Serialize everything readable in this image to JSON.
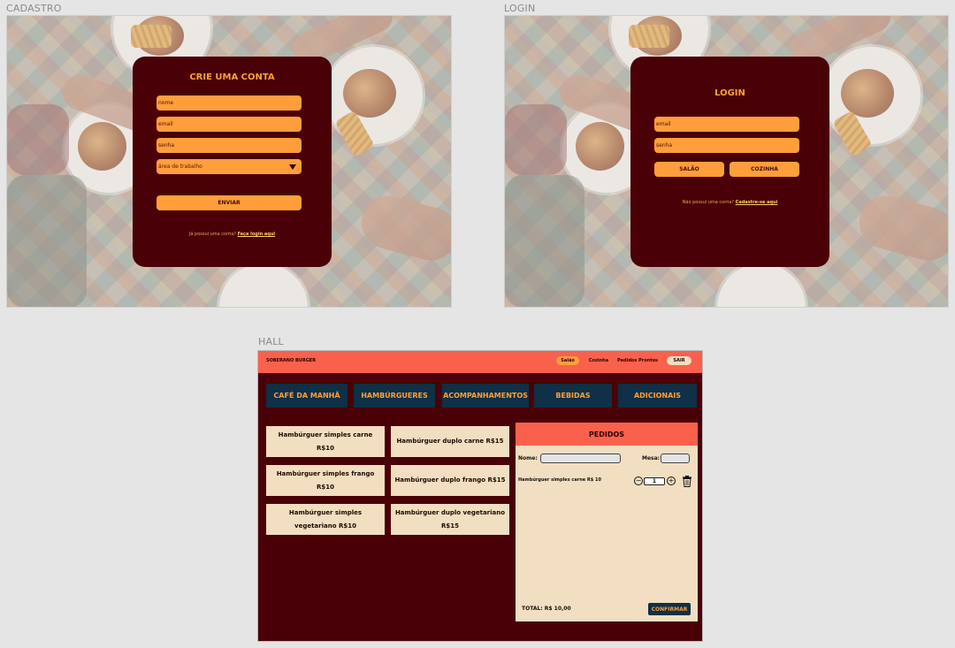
{
  "frames": {
    "cadastro_label": "CADASTRO",
    "login_label": "LOGIN",
    "hall_label": "HALL"
  },
  "cadastro": {
    "title": "CRIE UMA CONTA",
    "name_placeholder": "nome",
    "email_placeholder": "email",
    "password_placeholder": "senha",
    "area_placeholder": "área de trabalho",
    "submit_label": "ENVIAR",
    "footer_text": "Já possui uma conta?",
    "footer_link": "Faça login aqui"
  },
  "login": {
    "title": "LOGIN",
    "email_placeholder": "email",
    "password_placeholder": "senha",
    "salao_label": "SALÃO",
    "cozinha_label": "COZINHA",
    "footer_text": "Não possui uma conta?",
    "footer_link": "Cadastre-se aqui"
  },
  "hall": {
    "brand": "SOBERANO BURGER",
    "nav": {
      "salao": "Salão",
      "cozinha": "Cozinha",
      "prontos": "Pedidos Prontos",
      "sair": "SAIR"
    },
    "categories": [
      "CAFÉ DA MANHÃ",
      "HAMBÚRGUERES",
      "ACOMPANHAMENTOS",
      "BEBIDAS",
      "ADICIONAIS"
    ],
    "items": [
      "Hambúrguer simples carne R$10",
      "Hambúrguer duplo carne R$15",
      "Hambúrguer simples frango R$10",
      "Hambúrguer duplo frango R$15",
      "Hambúrguer simples vegetariano R$10",
      "Hambúrguer duplo vegetariano R$15"
    ],
    "orders": {
      "title": "PEDIDOS",
      "name_label": "Nome:",
      "table_label": "Mesa:",
      "line_item": "Hambúrguer simples carne R$ 10",
      "quantity": "1",
      "total": "TOTAL: R$ 10,00",
      "confirm_label": "CONFIRMAR"
    }
  },
  "colors": {
    "card_bg": "#490006",
    "accent_orange": "#ff9e3b",
    "header_coral": "#fa614c",
    "category_navy": "#0f3046",
    "item_cream": "#f2dec0"
  }
}
